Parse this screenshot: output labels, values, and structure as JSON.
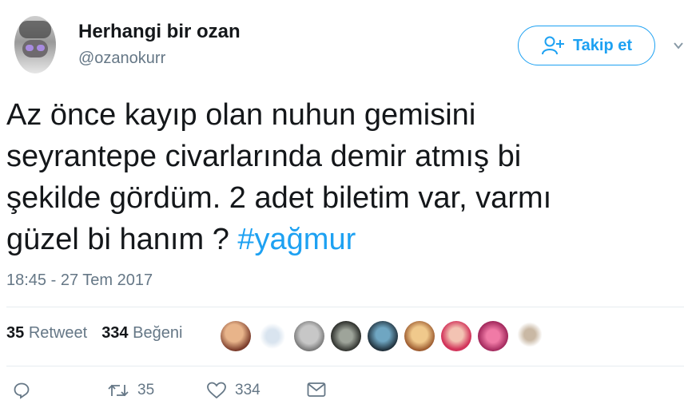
{
  "user": {
    "name": "Herhangi bir ozan",
    "handle": "@ozanokurr",
    "follow_label": "Takip et"
  },
  "tweet": {
    "lines": [
      "Az önce kayıp olan nuhun gemisini",
      "seyrantepe civarlarında demir atmış bi",
      "şekilde gördüm. 2 adet biletim var, varmı"
    ],
    "last_line_text": "güzel bi hanım ? ",
    "hashtag": "#yağmur",
    "timestamp": "18:45 - 27 Tem 2017"
  },
  "stats": {
    "retweets_count": "35",
    "retweets_label": "Retweet",
    "likes_count": "334",
    "likes_label": "Beğeni"
  },
  "actions": {
    "reply_icon": "reply-icon",
    "retweet_icon": "retweet-icon",
    "retweet_count": "35",
    "like_icon": "heart-icon",
    "like_count": "334",
    "message_icon": "envelope-icon"
  },
  "colors": {
    "accent": "#1da1f2",
    "muted": "#657786",
    "text": "#14171a"
  }
}
